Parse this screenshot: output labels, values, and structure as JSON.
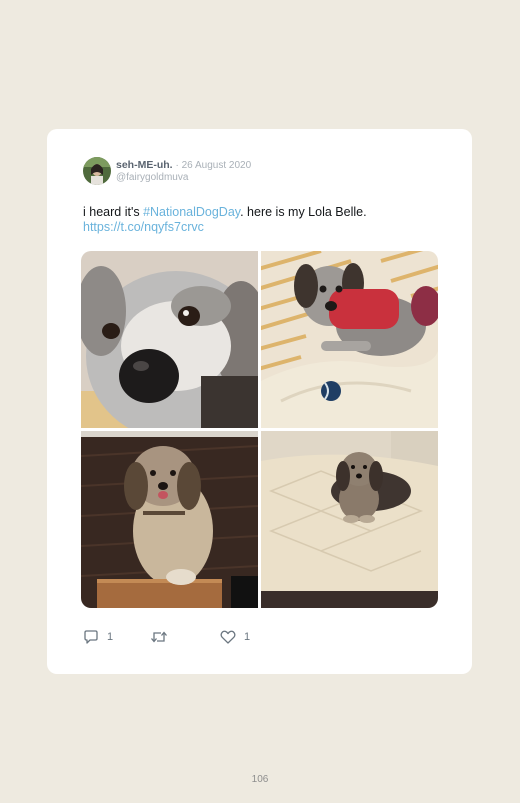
{
  "tweet": {
    "display_name": "seh-ME-uh.",
    "date": "· 26 August 2020",
    "handle": "@fairygoldmuva",
    "text_pre": "i heard it's ",
    "hashtag": "#NationalDogDay",
    "text_post": ". here is my Lola Belle.",
    "url": "https://t.co/nqyfs7crvc",
    "reply_count": "1",
    "retweet_count": "",
    "like_count": "1"
  },
  "icons": {
    "reply": "reply-icon",
    "retweet": "retweet-icon",
    "like": "heart-icon"
  },
  "page": {
    "number": "106"
  }
}
